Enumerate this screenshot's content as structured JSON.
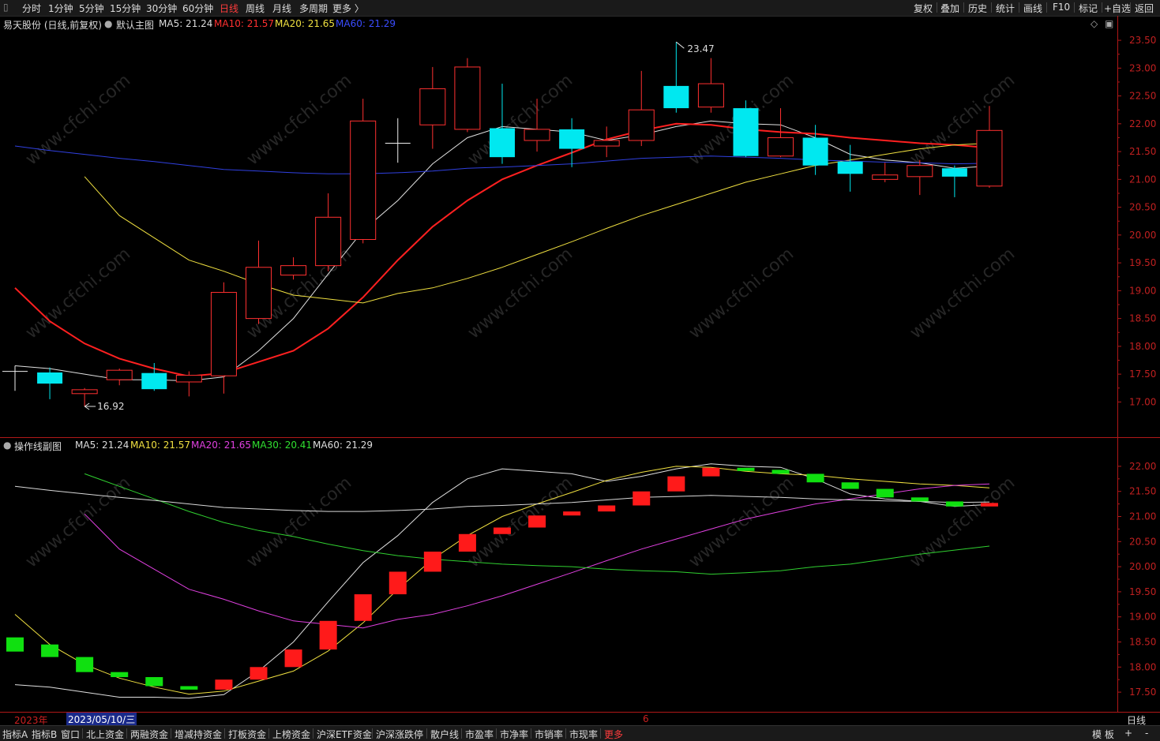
{
  "toolbar": {
    "periods": [
      "分时",
      "1分钟",
      "5分钟",
      "15分钟",
      "30分钟",
      "60分钟",
      "日线",
      "周线",
      "月线",
      "多周期",
      "更多 〉"
    ],
    "active": "日线",
    "right": [
      "复权",
      "叠加",
      "历史",
      "统计",
      "画线",
      "F10",
      "标记",
      "+自选",
      "返回"
    ]
  },
  "main": {
    "stock": "易天股份 (日线,前复权)",
    "chart_name": "默认主图",
    "ma5": "MA5: 21.24",
    "ma10": "MA10: 21.57",
    "ma20": "MA20: 21.65",
    "ma60": "MA60: 21.29",
    "high_label": "23.47",
    "low_label": "16.92",
    "axis": [
      "23.50",
      "23.00",
      "22.50",
      "22.00",
      "21.50",
      "21.00",
      "20.50",
      "20.00",
      "19.50",
      "19.00",
      "18.50",
      "18.00",
      "17.50",
      "17.00"
    ]
  },
  "sub": {
    "name": "操作线副图",
    "ma5": "MA5: 21.24",
    "ma10": "MA10: 21.57",
    "ma20": "MA20: 21.65",
    "ma30": "MA30: 20.41",
    "ma60": "MA60: 21.29",
    "axis": [
      "22.00",
      "21.50",
      "21.00",
      "20.50",
      "20.00",
      "19.50",
      "19.00",
      "18.50",
      "18.00",
      "17.50"
    ]
  },
  "date_row": {
    "year": "2023年",
    "date": "2023/05/10/三",
    "month_mark": "6",
    "period": "日线"
  },
  "bottom": {
    "tabs": [
      "指标A",
      "指标B",
      "窗口",
      "北上资金",
      "两融资金",
      "增减持资金",
      "打板资金",
      "上榜资金",
      "沪深ETF资金",
      "沪深涨跌停",
      "散户线",
      "市盈率",
      "市净率",
      "市销率",
      "市现率",
      "更多"
    ],
    "right": [
      "模 板",
      "+",
      "-"
    ]
  },
  "watermark": "www.cfchi.com",
  "chart_data": [
    {
      "type": "candlestick",
      "title": "易天股份 (日线,前复权)",
      "ylim": [
        16.75,
        23.65
      ],
      "candles": [
        {
          "o": 17.55,
          "c": 17.55,
          "h": 17.65,
          "l": 17.2
        },
        {
          "o": 17.53,
          "c": 17.33,
          "h": 17.62,
          "l": 17.05
        },
        {
          "o": 17.15,
          "c": 17.22,
          "h": 17.25,
          "l": 16.92
        },
        {
          "o": 17.4,
          "c": 17.57,
          "h": 17.6,
          "l": 17.3
        },
        {
          "o": 17.52,
          "c": 17.23,
          "h": 17.7,
          "l": 17.2
        },
        {
          "o": 17.36,
          "c": 17.48,
          "h": 17.55,
          "l": 17.1
        },
        {
          "o": 17.47,
          "c": 18.97,
          "h": 19.15,
          "l": 17.15
        },
        {
          "o": 18.5,
          "c": 19.42,
          "h": 19.9,
          "l": 18.4
        },
        {
          "o": 19.28,
          "c": 19.45,
          "h": 19.6,
          "l": 19.2
        },
        {
          "o": 19.45,
          "c": 20.32,
          "h": 20.75,
          "l": 19.35
        },
        {
          "o": 19.92,
          "c": 22.05,
          "h": 22.45,
          "l": 19.85
        },
        {
          "o": 21.65,
          "c": 21.65,
          "h": 22.1,
          "l": 21.3
        },
        {
          "o": 21.98,
          "c": 22.63,
          "h": 23.02,
          "l": 21.55
        },
        {
          "o": 21.9,
          "c": 23.02,
          "h": 23.18,
          "l": 21.85
        },
        {
          "o": 21.92,
          "c": 21.4,
          "h": 22.72,
          "l": 21.28
        },
        {
          "o": 21.7,
          "c": 21.9,
          "h": 22.45,
          "l": 21.5
        },
        {
          "o": 21.9,
          "c": 21.55,
          "h": 22.1,
          "l": 21.22
        },
        {
          "o": 21.6,
          "c": 21.7,
          "h": 21.95,
          "l": 21.4
        },
        {
          "o": 21.7,
          "c": 22.25,
          "h": 22.95,
          "l": 21.6
        },
        {
          "o": 22.68,
          "c": 22.28,
          "h": 23.47,
          "l": 22.2
        },
        {
          "o": 22.3,
          "c": 22.72,
          "h": 23.18,
          "l": 22.2
        },
        {
          "o": 22.28,
          "c": 21.42,
          "h": 22.42,
          "l": 21.4
        },
        {
          "o": 21.42,
          "c": 21.75,
          "h": 22.28,
          "l": 21.4
        },
        {
          "o": 21.75,
          "c": 21.25,
          "h": 21.98,
          "l": 21.08
        },
        {
          "o": 21.32,
          "c": 21.1,
          "h": 21.62,
          "l": 20.78
        },
        {
          "o": 21.0,
          "c": 21.08,
          "h": 21.3,
          "l": 20.95
        },
        {
          "o": 21.05,
          "c": 21.25,
          "h": 21.35,
          "l": 20.72
        },
        {
          "o": 21.2,
          "c": 21.05,
          "h": 21.25,
          "l": 20.68
        },
        {
          "o": 20.88,
          "c": 21.88,
          "h": 22.32,
          "l": 20.85
        }
      ],
      "series": [
        {
          "name": "MA5",
          "values": [
            17.65,
            17.6,
            17.5,
            17.4,
            17.4,
            17.38,
            17.45,
            17.92,
            18.5,
            19.3,
            20.08,
            20.62,
            21.28,
            21.75,
            21.95,
            21.9,
            21.85,
            21.7,
            21.8,
            21.95,
            22.05,
            22.0,
            21.98,
            21.75,
            21.45,
            21.35,
            21.3,
            21.2,
            21.24
          ]
        },
        {
          "name": "MA10",
          "values": [
            19.05,
            18.45,
            18.05,
            17.78,
            17.6,
            17.46,
            17.52,
            17.72,
            17.92,
            18.32,
            18.88,
            19.55,
            20.15,
            20.62,
            21.0,
            21.25,
            21.48,
            21.72,
            21.88,
            22.0,
            21.98,
            21.9,
            21.85,
            21.82,
            21.75,
            21.7,
            21.65,
            21.62,
            21.57
          ]
        },
        {
          "name": "MA20",
          "values": [
            21.05,
            20.35,
            19.95,
            19.55,
            19.35,
            19.12,
            18.92,
            18.85,
            18.78,
            18.95,
            19.05,
            19.22,
            19.42,
            19.65,
            19.88,
            20.12,
            20.35,
            20.55,
            20.75,
            20.95,
            21.1,
            21.25,
            21.35,
            21.45,
            21.55,
            21.62,
            21.65
          ]
        },
        {
          "name": "MA60",
          "values": [
            21.6,
            21.52,
            21.45,
            21.38,
            21.32,
            21.25,
            21.18,
            21.15,
            21.12,
            21.1,
            21.1,
            21.12,
            21.15,
            21.2,
            21.22,
            21.25,
            21.28,
            21.33,
            21.38,
            21.4,
            21.42,
            21.4,
            21.38,
            21.35,
            21.33,
            21.31,
            21.3,
            21.28,
            21.29
          ]
        }
      ]
    },
    {
      "type": "bar",
      "title": "操作线副图",
      "ylim": [
        17.25,
        22.25
      ],
      "bars": [
        18.45,
        18.2,
        17.9,
        17.8,
        17.62,
        17.55,
        17.75,
        18.0,
        18.35,
        18.92,
        19.45,
        19.9,
        20.3,
        20.65,
        20.78,
        21.02,
        21.1,
        21.22,
        21.5,
        21.8,
        21.97,
        21.93,
        21.85,
        21.68,
        21.55,
        21.38,
        21.3,
        21.2,
        21.27
      ],
      "series": [
        {
          "name": "MA5",
          "values": [
            17.65,
            17.6,
            17.5,
            17.4,
            17.4,
            17.38,
            17.45,
            17.92,
            18.5,
            19.3,
            20.08,
            20.62,
            21.28,
            21.75,
            21.95,
            21.9,
            21.85,
            21.7,
            21.8,
            21.95,
            22.05,
            22.0,
            21.98,
            21.75,
            21.45,
            21.35,
            21.3,
            21.2,
            21.24
          ]
        },
        {
          "name": "MA10",
          "values": [
            19.05,
            18.45,
            18.05,
            17.78,
            17.6,
            17.46,
            17.52,
            17.72,
            17.92,
            18.32,
            18.88,
            19.55,
            20.15,
            20.62,
            21.0,
            21.25,
            21.48,
            21.72,
            21.88,
            22.0,
            21.98,
            21.9,
            21.85,
            21.82,
            21.75,
            21.7,
            21.65,
            21.62,
            21.57
          ]
        },
        {
          "name": "MA20",
          "values": [
            21.05,
            20.35,
            19.95,
            19.55,
            19.35,
            19.12,
            18.92,
            18.85,
            18.78,
            18.95,
            19.05,
            19.22,
            19.42,
            19.65,
            19.88,
            20.12,
            20.35,
            20.55,
            20.75,
            20.95,
            21.1,
            21.25,
            21.35,
            21.45,
            21.55,
            21.62,
            21.65
          ]
        },
        {
          "name": "MA30",
          "values": [
            21.85,
            21.6,
            21.35,
            21.1,
            20.88,
            20.72,
            20.6,
            20.45,
            20.32,
            20.22,
            20.15,
            20.1,
            20.05,
            20.02,
            20.0,
            19.95,
            19.92,
            19.9,
            19.85,
            19.88,
            19.92,
            20.0,
            20.05,
            20.15,
            20.25,
            20.33,
            20.41
          ]
        },
        {
          "name": "MA60",
          "values": [
            21.6,
            21.52,
            21.45,
            21.38,
            21.32,
            21.25,
            21.18,
            21.15,
            21.12,
            21.1,
            21.1,
            21.12,
            21.15,
            21.2,
            21.22,
            21.25,
            21.28,
            21.33,
            21.38,
            21.4,
            21.42,
            21.4,
            21.38,
            21.35,
            21.33,
            21.31,
            21.3,
            21.28,
            21.29
          ]
        }
      ]
    }
  ]
}
